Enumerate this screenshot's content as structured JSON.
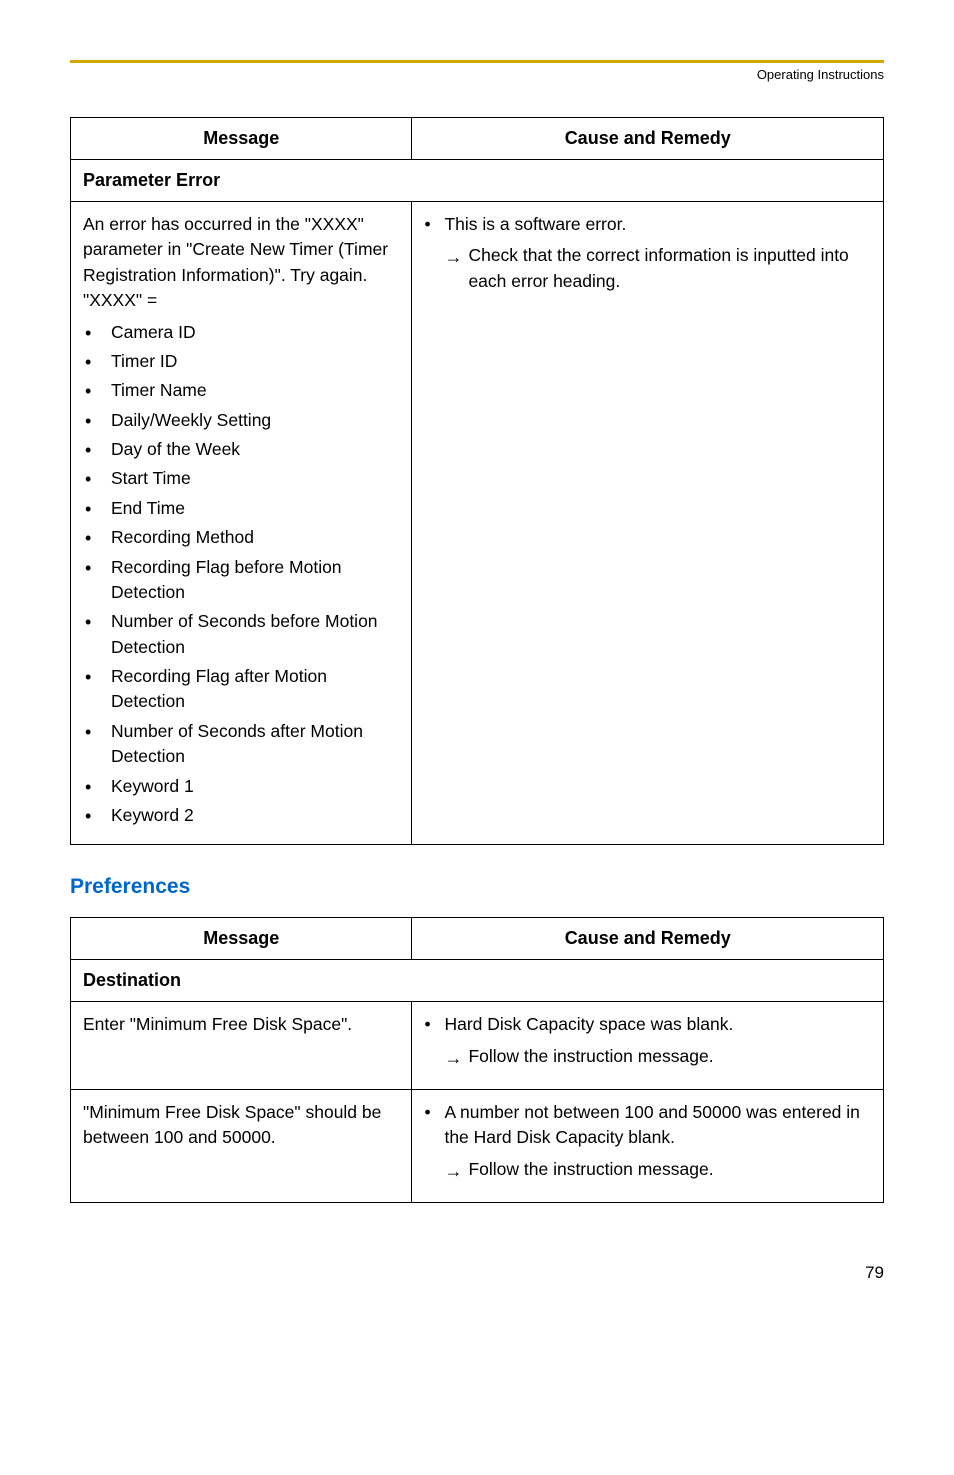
{
  "header": {
    "doc_title": "Operating Instructions"
  },
  "table1": {
    "headers": {
      "message": "Message",
      "remedy": "Cause and Remedy"
    },
    "section": "Parameter Error",
    "message_intro": "An error has occurred in the \"XXXX\" parameter in \"Create New Timer (Timer Registration Information)\". Try again.",
    "xxxx_label": "\"XXXX\" =",
    "items": [
      "Camera ID",
      "Timer ID",
      "Timer Name",
      "Daily/Weekly Setting",
      "Day of the Week",
      "Start Time",
      "End Time",
      "Recording Method",
      "Recording Flag before Motion Detection",
      "Number of Seconds before Motion Detection",
      "Recording Flag after Motion Detection",
      "Number of Seconds after Motion Detection",
      "Keyword 1",
      "Keyword 2"
    ],
    "remedy": {
      "cause": "This is a software error.",
      "action": "Check that the correct information is inputted into each error heading."
    }
  },
  "preferences_title": "Preferences",
  "table2": {
    "headers": {
      "message": "Message",
      "remedy": "Cause and Remedy"
    },
    "section": "Destination",
    "rows": [
      {
        "message": "Enter \"Minimum Free Disk Space\".",
        "cause": "Hard Disk Capacity space was blank.",
        "action": "Follow the instruction message."
      },
      {
        "message": "\"Minimum Free Disk Space\" should be between 100 and 50000.",
        "cause": "A number not between 100 and 50000 was entered in the Hard Disk Capacity blank.",
        "action": "Follow the instruction message."
      }
    ]
  },
  "page_number": "79"
}
